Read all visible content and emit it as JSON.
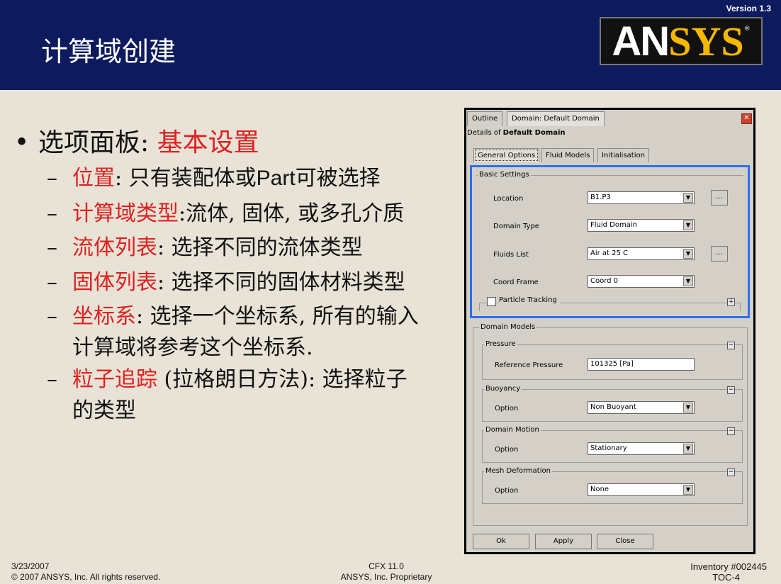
{
  "header": {
    "title": "计算域创建",
    "version": "Version 1.3",
    "logo": {
      "an": "AN",
      "sys": "SYS",
      "r": "®"
    }
  },
  "bullets": {
    "main": {
      "prefix": "选项面板: ",
      "highlight": "基本设置"
    },
    "items": [
      {
        "red": "位置",
        "text1": ": 只有装配体或",
        "sans": "Part",
        "text2": "可被选择"
      },
      {
        "red": "计算域类型",
        "text1": ":流体, 固体, 或多孔介质"
      },
      {
        "red": "流体列表",
        "text1": ": 选择不同的流体类型"
      },
      {
        "red": "固体列表",
        "text1": ": 选择不同的固体材料类型"
      },
      {
        "red": "坐标系",
        "text1": ": 选择一个坐标系, 所有的输入",
        "line2": "计算域将参考这个坐标系."
      },
      {
        "red": "粒子追踪",
        "text1": " (拉格朗日方法): 选择粒子",
        "line2": "的类型"
      }
    ]
  },
  "dialog": {
    "tabs": [
      "Outline",
      "Domain: Default Domain"
    ],
    "details_prefix": "Details of ",
    "details_bold": "Default Domain",
    "subtabs": [
      "General Options",
      "Fluid Models",
      "Initialisation"
    ],
    "basic_settings": {
      "title": "Basic Settings",
      "location_label": "Location",
      "location_value": "B1.P3",
      "domain_type_label": "Domain Type",
      "domain_type_value": "Fluid Domain",
      "fluids_list_label": "Fluids List",
      "fluids_list_value": "Air at 25 C",
      "coord_frame_label": "Coord Frame",
      "coord_frame_value": "Coord 0",
      "particle_tracking_label": "Particle Tracking",
      "ellipsis": "..."
    },
    "domain_models": {
      "title": "Domain Models",
      "pressure_title": "Pressure",
      "reference_pressure_label": "Reference Pressure",
      "reference_pressure_value": "101325 [Pa]",
      "buoyancy_title": "Buoyancy",
      "buoyancy_option_label": "Option",
      "buoyancy_option_value": "Non Buoyant",
      "domain_motion_title": "Domain Motion",
      "domain_motion_option_label": "Option",
      "domain_motion_option_value": "Stationary",
      "mesh_deformation_title": "Mesh Deformation",
      "mesh_deformation_option_label": "Option",
      "mesh_deformation_option_value": "None"
    },
    "buttons": {
      "ok": "Ok",
      "apply": "Apply",
      "close": "Close"
    }
  },
  "footer": {
    "date": "3/23/2007",
    "copyright": "© 2007 ANSYS, Inc.  All rights reserved.",
    "product": "CFX 11.0",
    "proprietary": "ANSYS, Inc. Proprietary",
    "inventory": "Inventory #002445",
    "toc": "TOC-4"
  }
}
